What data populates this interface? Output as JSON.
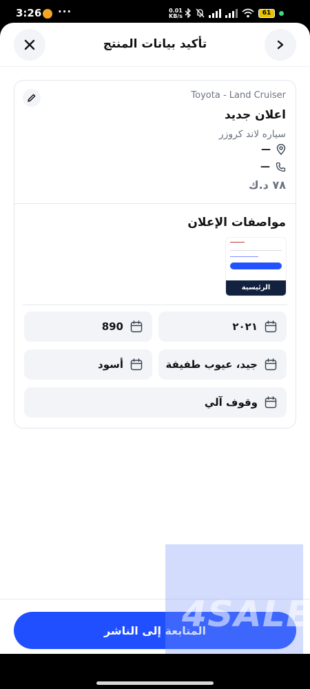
{
  "status_bar": {
    "time": "3:26",
    "dots": "···",
    "net_speed_value": "0.01",
    "net_speed_unit": "KB/s",
    "battery": "61"
  },
  "header": {
    "title": "تأكيد بيانات المنتج"
  },
  "listing": {
    "car_model": "Toyota - Land Cruiser",
    "title": "اعلان جديد",
    "description": "سياره لاند كروزر",
    "location": "—",
    "phone": "—",
    "price": "٧٨ د.ك"
  },
  "specs": {
    "title": "مواصفات الإعلان",
    "thumbnail_label": "الرئيسية",
    "fields": [
      {
        "value": "٢٠٢١",
        "icon": "calendar-icon"
      },
      {
        "value": "890",
        "icon": "calendar-icon"
      },
      {
        "value": "جيد، عيوب طفيفة",
        "icon": "calendar-icon"
      },
      {
        "value": "أسود",
        "icon": "calendar-icon"
      },
      {
        "value": "وقوف آلي",
        "icon": "calendar-icon"
      }
    ]
  },
  "footer": {
    "continue_label": "المتابعة إلى الناشر"
  },
  "watermark": {
    "text": "4SALE"
  },
  "colors": {
    "primary": "#1f4fff",
    "chip_bg": "#f2f4f7",
    "text_muted": "#6b7280"
  }
}
